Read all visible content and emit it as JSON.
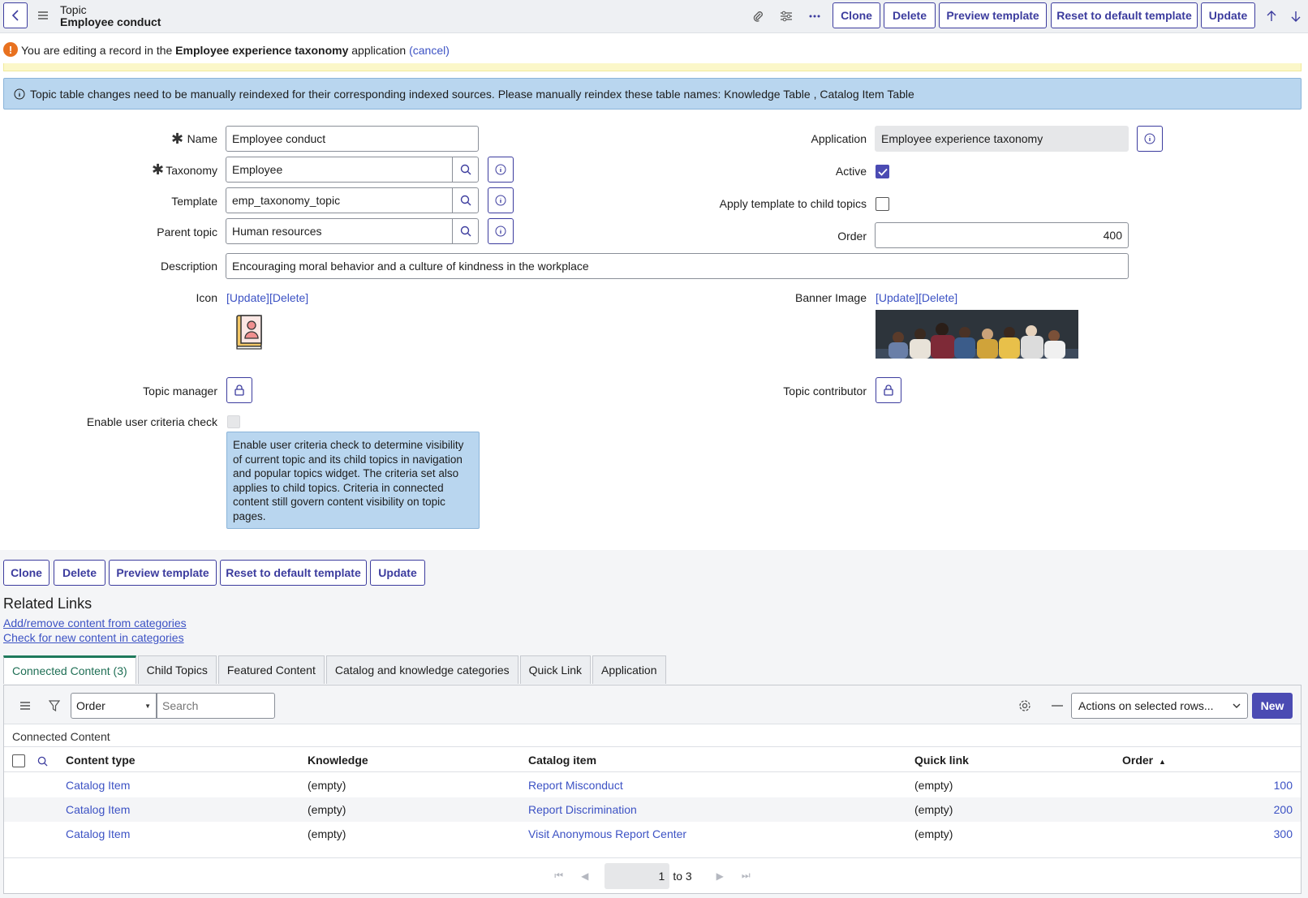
{
  "header": {
    "record_type": "Topic",
    "record_name": "Employee conduct",
    "buttons": {
      "clone": "Clone",
      "delete": "Delete",
      "preview": "Preview template",
      "reset": "Reset to default template",
      "update": "Update"
    }
  },
  "notice": {
    "prefix": "You are editing a record in the",
    "app_name": "Employee experience taxonomy",
    "suffix": "application",
    "cancel": "(cancel)"
  },
  "info_message": "Topic table changes need to be manually reindexed for their corresponding indexed sources. Please manually reindex these table names: Knowledge Table , Catalog Item Table",
  "form": {
    "name_label": "Name",
    "name_value": "Employee conduct",
    "taxonomy_label": "Taxonomy",
    "taxonomy_value": "Employee",
    "template_label": "Template",
    "template_value": "emp_taxonomy_topic",
    "parent_label": "Parent topic",
    "parent_value": "Human resources",
    "description_label": "Description",
    "description_value": "Encouraging moral behavior and a culture of kindness in the workplace",
    "icon_label": "Icon",
    "icon_update": "[Update]",
    "icon_delete": "[Delete]",
    "application_label": "Application",
    "application_value": "Employee experience taxonomy",
    "active_label": "Active",
    "active_checked": true,
    "apply_template_label": "Apply template to child topics",
    "apply_template_checked": false,
    "order_label": "Order",
    "order_value": "400",
    "banner_label": "Banner Image",
    "banner_update": "[Update]",
    "banner_delete": "[Delete]",
    "topic_manager_label": "Topic manager",
    "topic_contributor_label": "Topic contributor",
    "user_criteria_label": "Enable user criteria check",
    "user_criteria_help": "Enable user criteria check to determine visibility of current topic and its child topics in navigation and popular topics widget. The criteria set also applies to child topics. Criteria in connected content still govern content visibility on topic pages."
  },
  "bottom_buttons": {
    "clone": "Clone",
    "delete": "Delete",
    "preview": "Preview template",
    "reset": "Reset to default template",
    "update": "Update"
  },
  "related_links": {
    "title": "Related Links",
    "links": [
      "Add/remove content from categories",
      "Check for new content in categories"
    ]
  },
  "tabs": [
    "Connected Content (3)",
    "Child Topics",
    "Featured Content",
    "Catalog and knowledge categories",
    "Quick Link",
    "Application"
  ],
  "list": {
    "filter_field": "Order",
    "search_placeholder": "Search",
    "actions_select": "Actions on selected rows...",
    "new_button": "New",
    "title": "Connected Content",
    "columns": [
      "Content type",
      "Knowledge",
      "Catalog item",
      "Quick link",
      "Order"
    ],
    "rows": [
      {
        "content_type": "Catalog Item",
        "knowledge": "(empty)",
        "catalog_item": "Report Misconduct",
        "quick_link": "(empty)",
        "order": "100"
      },
      {
        "content_type": "Catalog Item",
        "knowledge": "(empty)",
        "catalog_item": "Report Discrimination",
        "quick_link": "(empty)",
        "order": "200"
      },
      {
        "content_type": "Catalog Item",
        "knowledge": "(empty)",
        "catalog_item": "Visit Anonymous Report Center",
        "quick_link": "(empty)",
        "order": "300"
      }
    ],
    "pagination": {
      "current": "1",
      "of_text": "to 3"
    }
  },
  "colors": {
    "accent": "#3c3c9e",
    "info_bg": "#b9d6ef",
    "warning_bg": "#fbf7c9",
    "active_tab": "#1f7a5c",
    "link": "#3c52c4"
  }
}
